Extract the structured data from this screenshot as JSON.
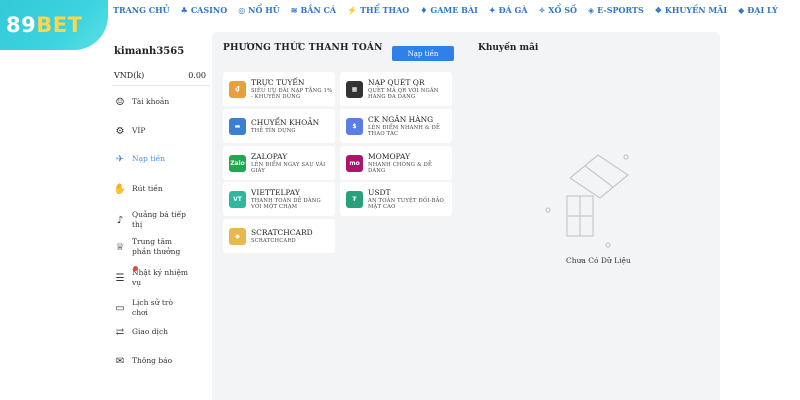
{
  "logo": {
    "part1": "89",
    "part2": "BET"
  },
  "topnav": [
    {
      "label": "TRANG CHỦ",
      "icon": "home-icon",
      "glyph": ""
    },
    {
      "label": "CASINO",
      "icon": "casino-icon",
      "glyph": "♣"
    },
    {
      "label": "NỔ HŨ",
      "icon": "jackpot-icon",
      "glyph": "◎"
    },
    {
      "label": "BẮN CÁ",
      "icon": "fish-icon",
      "glyph": "≋"
    },
    {
      "label": "THỂ THAO",
      "icon": "sports-icon",
      "glyph": "⚡"
    },
    {
      "label": "GAME BÀI",
      "icon": "cards-icon",
      "glyph": "♦"
    },
    {
      "label": "ĐÁ GÀ",
      "icon": "cockfight-icon",
      "glyph": "✦"
    },
    {
      "label": "XỔ SỐ",
      "icon": "lottery-icon",
      "glyph": "✧"
    },
    {
      "label": "E-SPORTS",
      "icon": "gamepad-icon",
      "glyph": "◈"
    },
    {
      "label": "KHUYẾN MÃI",
      "icon": "gift-icon",
      "glyph": "❖"
    },
    {
      "label": "ĐẠI LÝ",
      "icon": "agent-icon",
      "glyph": "◆"
    }
  ],
  "sidebar": {
    "username": "kimanh3565",
    "currency": "VND(k)",
    "balance": "0.00",
    "items": [
      {
        "label": "Tài khoản",
        "icon": "user-icon",
        "glyph": "☺"
      },
      {
        "label": "VIP",
        "icon": "vip-icon",
        "glyph": "⚙"
      },
      {
        "label": "Nạp tiền",
        "icon": "deposit-icon",
        "glyph": "✈",
        "active": true
      },
      {
        "label": "Rút tiền",
        "icon": "withdraw-icon",
        "glyph": "✋"
      },
      {
        "label": "Quảng bá tiếp thị",
        "icon": "megaphone-icon",
        "glyph": "♪"
      },
      {
        "label": "Trung tâm phần thưởng",
        "icon": "reward-icon",
        "glyph": "♕"
      },
      {
        "label": "Nhật ký nhiệm vụ",
        "icon": "task-icon",
        "glyph": "☰",
        "badge": true
      },
      {
        "label": "Lịch sử trò chơi",
        "icon": "history-icon",
        "glyph": "▭"
      },
      {
        "label": "Giao dịch",
        "icon": "transaction-icon",
        "glyph": "⇄"
      },
      {
        "label": "Thông báo",
        "icon": "mail-icon",
        "glyph": "✉"
      }
    ]
  },
  "payment": {
    "title": "PHƯƠNG THỨC THANH TOÁN",
    "deposit_button": "Nạp tiền",
    "methods": [
      {
        "name": "TRỰC TUYẾN",
        "desc": "SIÊU ƯU ĐÃI NẠP TẶNG 1% - KHUYẾN DÙNG",
        "icon": "online-banking-icon",
        "badge": "₫",
        "color": "#e8a13a"
      },
      {
        "name": "NẠP QUÉT QR",
        "desc": "QUÉT MÃ QR VỚI NGÂN HÀNG ĐA DẠNG",
        "icon": "qr-code-icon",
        "badge": "▦",
        "color": "#333333"
      },
      {
        "name": "CHUYỂN KHOẢN",
        "desc": "THẺ TÍN DỤNG",
        "icon": "bank-transfer-icon",
        "badge": "▬",
        "color": "#3b7fd4"
      },
      {
        "name": "CK NGÂN HÀNG",
        "desc": "LÊN ĐIỂM NHANH & DỄ THAO TÁC",
        "icon": "bank-icon",
        "badge": "$",
        "color": "#5a7de8"
      },
      {
        "name": "ZALOPAY",
        "desc": "LÊN ĐIỂM NGAY SAU VÀI GIÂY",
        "icon": "zalopay-icon",
        "badge": "Zalo",
        "color": "#21a84d"
      },
      {
        "name": "MOMOPAY",
        "desc": "NHANH CHÓNG & DỄ DÀNG",
        "icon": "momo-icon",
        "badge": "mo",
        "color": "#b0126e"
      },
      {
        "name": "VIETTELPAY",
        "desc": "THANH TOÁN DỄ DÀNG VỚI MỘT CHẠM",
        "icon": "viettelpay-icon",
        "badge": "VT",
        "color": "#2db89b"
      },
      {
        "name": "USDT",
        "desc": "AN TOÀN TUYỆT ĐỐI-BẢO MẬT CAO",
        "icon": "usdt-icon",
        "badge": "₮",
        "color": "#26a17b"
      },
      {
        "name": "SCRATCHCARD",
        "desc": "SCRATCHCARD",
        "icon": "scratchcard-icon",
        "badge": "◆",
        "color": "#e9b84a"
      }
    ]
  },
  "promotions": {
    "title": "Khuyến mãi",
    "empty_text": "Chưa Có Dữ Liệu"
  }
}
